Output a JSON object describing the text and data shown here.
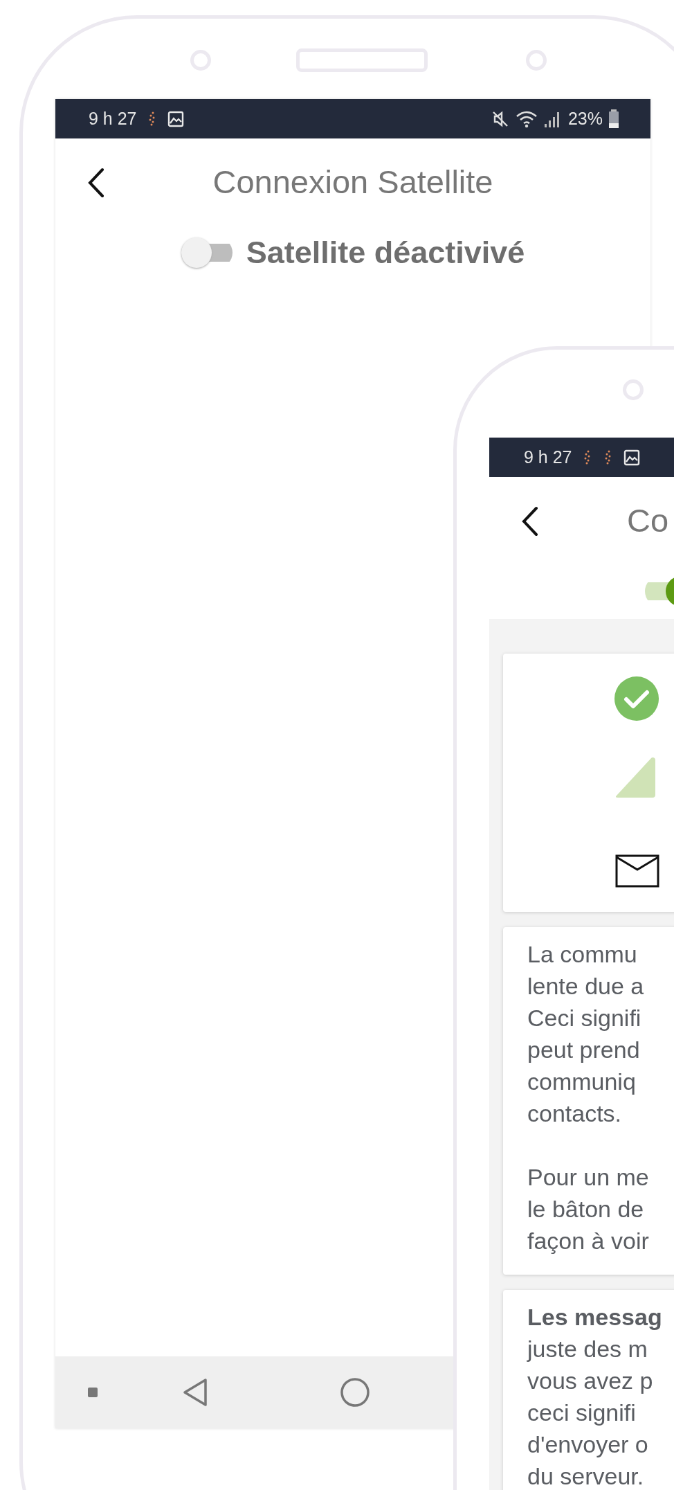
{
  "phones": [
    {
      "status_bar": {
        "time": "9 h 27",
        "battery": "23%"
      },
      "header": {
        "title": "Connexion Satellite"
      },
      "satellite_toggle": {
        "on": false,
        "label": "Satellite déactivivé"
      }
    },
    {
      "status_bar": {
        "time": "9 h 27"
      },
      "header": {
        "title": "Co"
      },
      "satellite_toggle": {
        "on": true
      },
      "cards": [
        {
          "paragraphs": [
            [
              "La commu",
              "lente due a",
              "Ceci signifi",
              "peut prend",
              "communiq",
              "contacts."
            ],
            [
              "Pour un me",
              "le bâton de",
              "façon à voir"
            ]
          ]
        },
        {
          "paragraphs": [
            [
              "**Les messag**",
              "juste des m",
              "vous avez p",
              "ceci signifi",
              "d'envoyer o",
              "du serveur."
            ]
          ]
        }
      ]
    }
  ]
}
